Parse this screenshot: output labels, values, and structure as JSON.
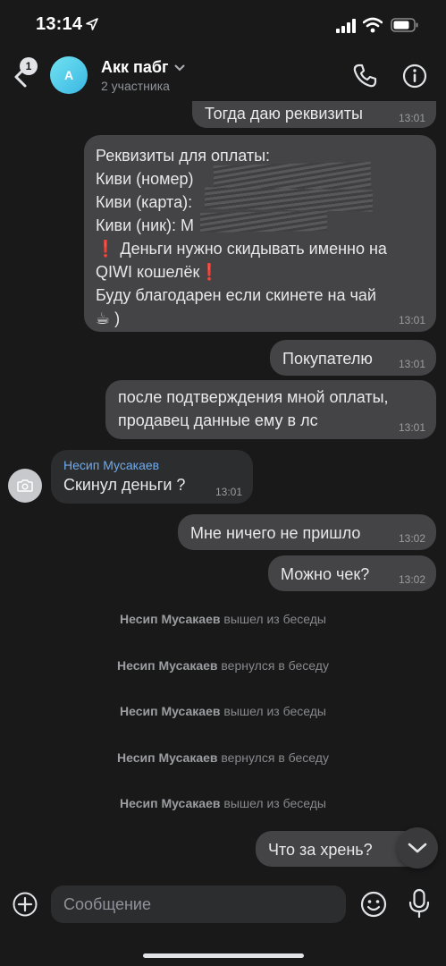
{
  "status_bar": {
    "time": "13:14"
  },
  "header": {
    "back_badge": "1",
    "avatar_letter": "A",
    "title": "Акк пабг",
    "subtitle": "2 участника"
  },
  "messages": {
    "m1": {
      "text": "Тогда даю реквизиты",
      "time": "13:01"
    },
    "m2": {
      "lines": [
        "Реквизиты для оплаты:",
        "Киви (номер)",
        "Киви (карта):",
        "Киви (ник): M",
        "❗ Деньги нужно скидывать именно на",
        "QIWI кошелёк❗",
        "Буду благодарен если скинете на чай",
        "☕ )"
      ],
      "time": "13:01"
    },
    "m3": {
      "text": "Покупателю",
      "time": "13:01"
    },
    "m4": {
      "lines": [
        "после подтверждения мной оплаты,",
        "продавец данные ему в лс"
      ],
      "time": "13:01"
    },
    "m5": {
      "sender": "Несип Мусакаев",
      "text": "Скинул деньги ?",
      "time": "13:01"
    },
    "m6": {
      "text": "Мне ничего не пришло",
      "time": "13:02"
    },
    "m7": {
      "text": "Можно чек?",
      "time": "13:02"
    },
    "m8": {
      "text": "Что за хрень?"
    }
  },
  "system": [
    {
      "name": "Несип Мусакаев",
      "action": "вышел из беседы"
    },
    {
      "name": "Несип Мусакаев",
      "action": "вернулся в беседу"
    },
    {
      "name": "Несип Мусакаев",
      "action": "вышел из беседы"
    },
    {
      "name": "Несип Мусакаев",
      "action": "вернулся в беседу"
    },
    {
      "name": "Несип Мусакаев",
      "action": "вышел из беседы"
    }
  ],
  "composer": {
    "placeholder": "Сообщение"
  },
  "colors": {
    "background": "#19191a",
    "bubble_out": "#444446",
    "bubble_in": "#2c2d2e",
    "accent_name": "#71aaeb"
  },
  "icons": [
    "location-arrow-icon",
    "signal-icon",
    "wifi-icon",
    "battery-icon",
    "back-chevron-icon",
    "chevron-down-icon",
    "phone-icon",
    "info-icon",
    "camera-icon",
    "scroll-down-icon",
    "plus-icon",
    "smile-icon",
    "microphone-icon"
  ]
}
